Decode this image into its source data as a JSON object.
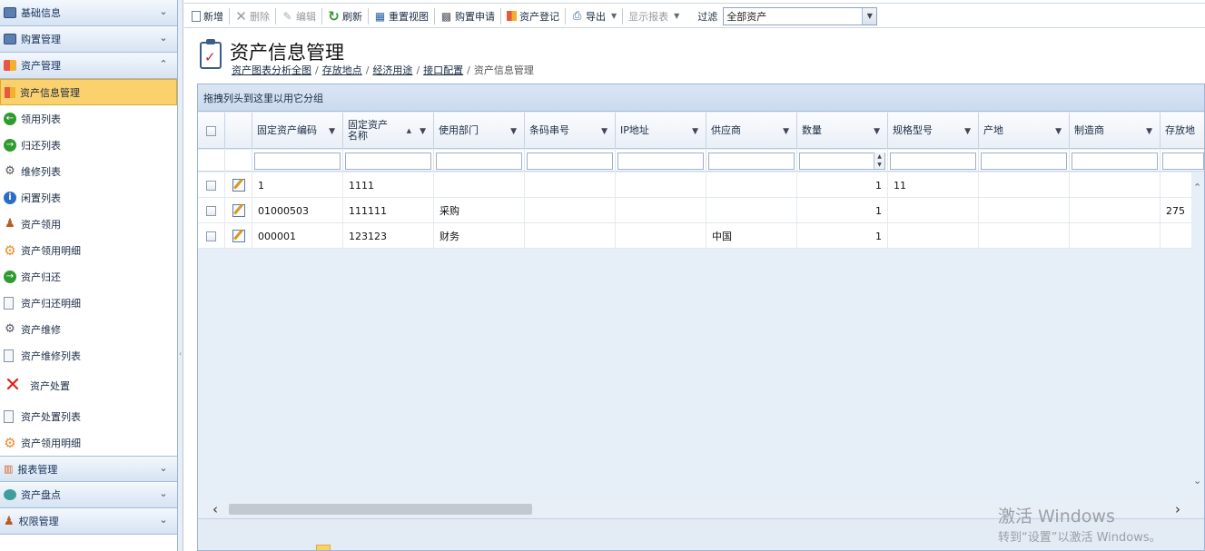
{
  "sidebar": {
    "groups_top": [
      {
        "label": "基础信息",
        "icon": "table-icon"
      },
      {
        "label": "购置管理",
        "icon": "table-icon"
      },
      {
        "label": "资产管理",
        "icon": "asset-icon"
      }
    ],
    "items": [
      {
        "label": "资产信息管理",
        "icon": "asset-icon",
        "active": true
      },
      {
        "label": "领用列表",
        "icon": "arrow-circle-icon"
      },
      {
        "label": "归还列表",
        "icon": "arrow-circle-icon"
      },
      {
        "label": "维修列表",
        "icon": "wrench-icon"
      },
      {
        "label": "闲置列表",
        "icon": "info-icon"
      },
      {
        "label": "资产领用",
        "icon": "user-icon"
      },
      {
        "label": "资产领用明细",
        "icon": "gear-icon"
      },
      {
        "label": "资产归还",
        "icon": "arrow-circle-icon"
      },
      {
        "label": "资产归还明细",
        "icon": "document-icon"
      },
      {
        "label": "资产维修",
        "icon": "wrench-icon"
      },
      {
        "label": "资产维修列表",
        "icon": "document-icon"
      },
      {
        "label": "资产处置",
        "icon": "red-x-icon"
      },
      {
        "label": "资产处置列表",
        "icon": "document-icon"
      },
      {
        "label": "资产领用明细",
        "icon": "gear-icon"
      }
    ],
    "groups_bottom": [
      {
        "label": "报表管理",
        "icon": "bar-chart-icon"
      },
      {
        "label": "资产盘点",
        "icon": "disc-icon"
      },
      {
        "label": "权限管理",
        "icon": "user-icon"
      }
    ]
  },
  "toolbar": {
    "new": "新增",
    "delete": "删除",
    "edit": "编辑",
    "refresh": "刷新",
    "reset_view": "重置视图",
    "purchase_request": "购置申请",
    "asset_register": "资产登记",
    "export": "导出",
    "show_report": "显示报表",
    "filter_label": "过滤",
    "filter_value": "全部资产"
  },
  "page": {
    "title": "资产信息管理",
    "breadcrumb": [
      "资产图表分析全图",
      "存放地点",
      "经济用途",
      "接口配置"
    ],
    "breadcrumb_current": "资产信息管理"
  },
  "grid": {
    "group_panel_text": "拖拽列头到这里以用它分组",
    "columns": [
      {
        "label": "固定资产编码"
      },
      {
        "label": "固定资产名称"
      },
      {
        "label": "使用部门"
      },
      {
        "label": "条码串号"
      },
      {
        "label": "IP地址"
      },
      {
        "label": "供应商"
      },
      {
        "label": "数量"
      },
      {
        "label": "规格型号"
      },
      {
        "label": "产地"
      },
      {
        "label": "制造商"
      },
      {
        "label": "存放地"
      }
    ],
    "rows": [
      {
        "code": "1",
        "name": "1111",
        "dept": "",
        "barcode": "",
        "ip": "",
        "supplier": "",
        "qty": "1",
        "spec": "11",
        "origin": "",
        "maker": "",
        "location": ""
      },
      {
        "code": "01000503",
        "name": "111111",
        "dept": "采购",
        "barcode": "",
        "ip": "",
        "supplier": "",
        "qty": "1",
        "spec": "",
        "origin": "",
        "maker": "",
        "location": "275"
      },
      {
        "code": "000001",
        "name": "123123",
        "dept": "财务",
        "barcode": "",
        "ip": "",
        "supplier": "中国",
        "qty": "1",
        "spec": "",
        "origin": "",
        "maker": "",
        "location": ""
      }
    ]
  },
  "watermark": {
    "line1": "激活 Windows",
    "line2": "转到“设置”以激活 Windows。"
  }
}
